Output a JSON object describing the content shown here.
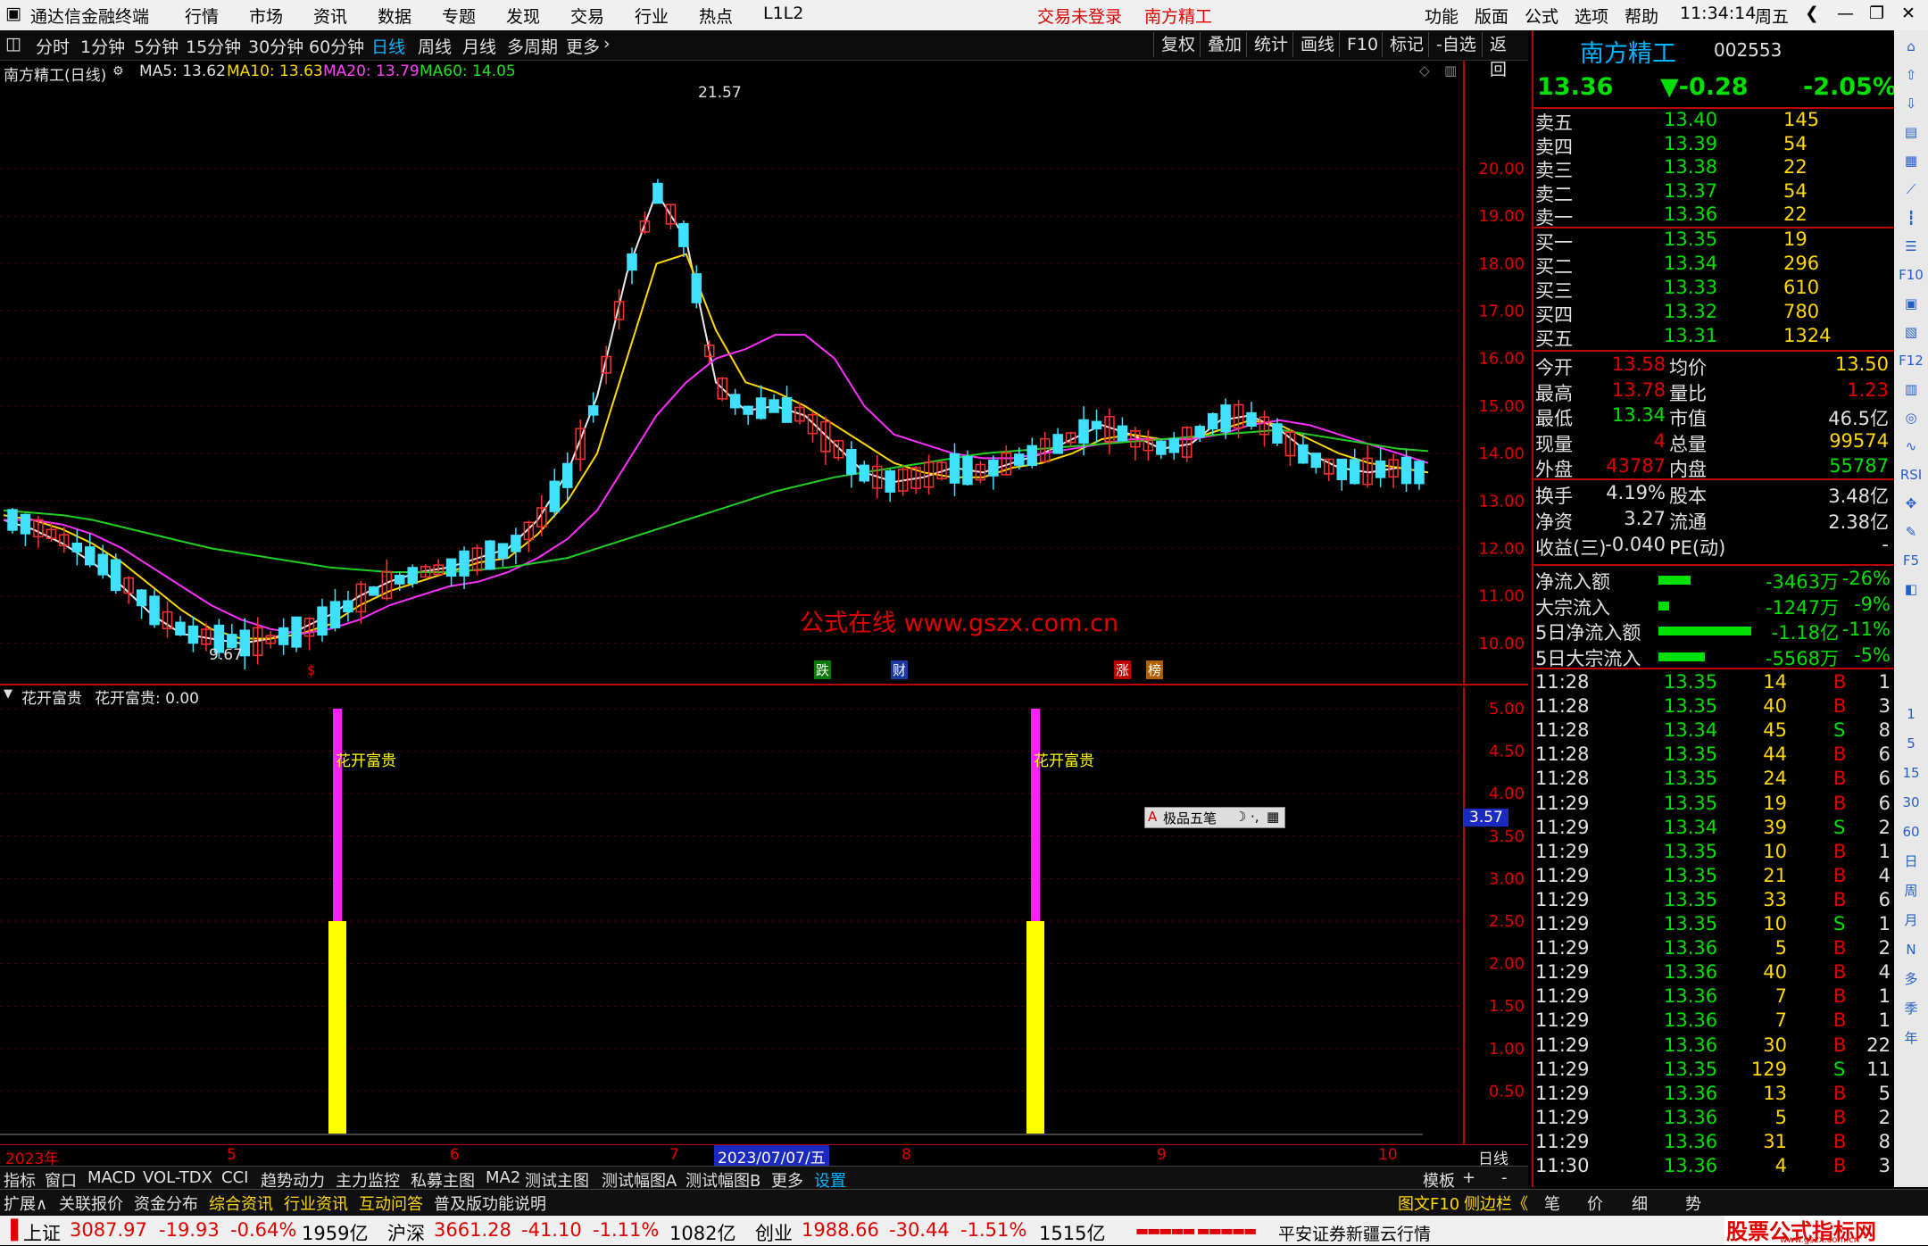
{
  "menubar": {
    "app_title": "通达信金融终端",
    "items": [
      "行情",
      "市场",
      "资讯",
      "数据",
      "专题",
      "发现",
      "交易",
      "行业",
      "热点",
      "L1L2"
    ],
    "login_status": "交易未登录",
    "stock_name": "南方精工",
    "right_items": [
      "功能",
      "版面",
      "公式",
      "选项",
      "帮助"
    ],
    "time": "11:34:14",
    "weekday": "周五"
  },
  "toolbar": {
    "periods": [
      "分时",
      "1分钟",
      "5分钟",
      "15分钟",
      "30分钟",
      "60分钟",
      "日线",
      "周线",
      "月线",
      "多周期",
      "更多"
    ],
    "active_period": "日线",
    "right_buttons": [
      "复权",
      "叠加",
      "统计",
      "画线",
      "F10",
      "标记",
      "-自选",
      "返回"
    ]
  },
  "main_chart": {
    "title": "南方精工(日线)",
    "ma": [
      {
        "label": "MA5: 13.62",
        "color": "#e0e0e0"
      },
      {
        "label": "MA10: 13.63",
        "color": "#ffd800"
      },
      {
        "label": "MA20: 13.79",
        "color": "#ff40ff"
      },
      {
        "label": "MA60: 14.05",
        "color": "#20e020"
      }
    ],
    "high_label": "21.57",
    "low_label": "9.67",
    "watermark": "公式在线  www.gszx.com.cn",
    "event_marks": [
      "$",
      "跌",
      "财",
      "涨",
      "榜"
    ]
  },
  "sub_chart": {
    "title": "花开富贵",
    "value_label": "花开富贵: 0.00",
    "bar_label": "花开富贵",
    "cursor_value": "3.57",
    "ime_label": "极品五笔"
  },
  "chart_data": [
    {
      "type": "bar",
      "title": "南方精工(日线)",
      "y_ticks": [
        20.0,
        19.0,
        18.0,
        17.0,
        16.0,
        15.0,
        14.0,
        13.0,
        12.0,
        11.0,
        10.0
      ],
      "ylim": [
        9.3,
        21.9
      ],
      "x_labels": [
        "2023年",
        "5",
        "6",
        "7",
        "8",
        "9",
        "10"
      ],
      "x_cursor_label": "2023/07/07/五",
      "series": [
        {
          "name": "MA5",
          "values": [
            12.6,
            12.4,
            12.1,
            11.7,
            11.2,
            10.6,
            10.2,
            10.1,
            10.0,
            10.1,
            10.3,
            10.6,
            11.0,
            11.3,
            11.5,
            11.6,
            11.8,
            12.0,
            12.6,
            13.6,
            15.2,
            17.8,
            19.5,
            18.5,
            15.5,
            14.9,
            15.0,
            14.8,
            14.2,
            13.6,
            13.4,
            13.5,
            13.7,
            13.6,
            13.8,
            14.0,
            14.3,
            14.6,
            14.4,
            14.1,
            14.2,
            14.7,
            14.8,
            14.5,
            14.0,
            13.7,
            13.6,
            13.7,
            13.6
          ]
        },
        {
          "name": "MA10",
          "values": [
            12.7,
            12.6,
            12.4,
            12.1,
            11.7,
            11.2,
            10.7,
            10.3,
            10.1,
            10.1,
            10.2,
            10.4,
            10.8,
            11.1,
            11.3,
            11.5,
            11.7,
            11.8,
            12.3,
            13.0,
            14.0,
            16.0,
            18.0,
            18.2,
            16.6,
            15.5,
            15.3,
            15.0,
            14.6,
            14.2,
            13.8,
            13.6,
            13.5,
            13.5,
            13.7,
            13.8,
            14.0,
            14.3,
            14.4,
            14.3,
            14.3,
            14.5,
            14.7,
            14.6,
            14.3,
            14.0,
            13.8,
            13.7,
            13.6
          ]
        },
        {
          "name": "MA20",
          "values": [
            12.6,
            12.6,
            12.5,
            12.3,
            12.0,
            11.6,
            11.2,
            10.8,
            10.5,
            10.3,
            10.2,
            10.3,
            10.5,
            10.8,
            11.0,
            11.2,
            11.3,
            11.5,
            11.8,
            12.2,
            12.8,
            13.8,
            14.8,
            15.5,
            16.0,
            16.2,
            16.5,
            16.5,
            16.0,
            15.0,
            14.4,
            14.2,
            14.0,
            13.9,
            13.9,
            14.0,
            14.1,
            14.2,
            14.3,
            14.3,
            14.3,
            14.4,
            14.6,
            14.7,
            14.6,
            14.4,
            14.2,
            14.0,
            13.8
          ]
        },
        {
          "name": "MA60",
          "values": [
            12.8,
            12.75,
            12.7,
            12.6,
            12.45,
            12.3,
            12.15,
            12.0,
            11.9,
            11.8,
            11.7,
            11.6,
            11.55,
            11.5,
            11.5,
            11.5,
            11.55,
            11.6,
            11.7,
            11.8,
            12.0,
            12.2,
            12.4,
            12.6,
            12.8,
            13.0,
            13.2,
            13.35,
            13.5,
            13.6,
            13.7,
            13.8,
            13.9,
            14.0,
            14.05,
            14.1,
            14.15,
            14.2,
            14.25,
            14.3,
            14.35,
            14.4,
            14.45,
            14.5,
            14.4,
            14.3,
            14.2,
            14.1,
            14.05
          ]
        }
      ]
    },
    {
      "type": "bar",
      "title": "花开富贵",
      "y_ticks": [
        5.0,
        4.5,
        4.0,
        3.5,
        3.0,
        2.5,
        2.0,
        1.5,
        1.0,
        0.5
      ],
      "ylim": [
        0,
        5.0
      ],
      "signals": [
        {
          "x_index": 0,
          "value": 5.0,
          "top_color": "#ff20ff",
          "bottom_value": 2.5,
          "bottom_color": "#ffff00"
        },
        {
          "x_index": 1,
          "value": 5.0,
          "top_color": "#ff20ff",
          "bottom_value": 2.5,
          "bottom_color": "#ffff00"
        }
      ]
    }
  ],
  "quote": {
    "name": "南方精工",
    "code": "002553",
    "price": "13.36",
    "change": "▼-0.28",
    "pct": "-2.05%",
    "asks": [
      {
        "label": "卖五",
        "price": "13.40",
        "vol": "145"
      },
      {
        "label": "卖四",
        "price": "13.39",
        "vol": "54"
      },
      {
        "label": "卖三",
        "price": "13.38",
        "vol": "22"
      },
      {
        "label": "卖二",
        "price": "13.37",
        "vol": "54"
      },
      {
        "label": "卖一",
        "price": "13.36",
        "vol": "22"
      }
    ],
    "bids": [
      {
        "label": "买一",
        "price": "13.35",
        "vol": "19"
      },
      {
        "label": "买二",
        "price": "13.34",
        "vol": "296"
      },
      {
        "label": "买三",
        "price": "13.33",
        "vol": "610"
      },
      {
        "label": "买四",
        "price": "13.32",
        "vol": "780"
      },
      {
        "label": "买五",
        "price": "13.31",
        "vol": "1324"
      }
    ],
    "stats": [
      {
        "l1": "今开",
        "v1": "13.58",
        "l2": "均价",
        "v2": "13.50",
        "c1": "#e00000",
        "c2": "#ffd800"
      },
      {
        "l1": "最高",
        "v1": "13.78",
        "l2": "量比",
        "v2": "1.23",
        "c1": "#e00000",
        "c2": "#e00000"
      },
      {
        "l1": "最低",
        "v1": "13.34",
        "l2": "市值",
        "v2": "46.5亿",
        "c1": "#00e000",
        "c2": "#e0e0e0"
      },
      {
        "l1": "现量",
        "v1": "4",
        "l2": "总量",
        "v2": "99574",
        "c1": "#e00000",
        "c2": "#ffd800"
      },
      {
        "l1": "外盘",
        "v1": "43787",
        "l2": "内盘",
        "v2": "55787",
        "c1": "#e00000",
        "c2": "#00e000"
      }
    ],
    "stats2": [
      {
        "l1": "换手",
        "v1": "4.19%",
        "l2": "股本",
        "v2": "3.48亿"
      },
      {
        "l1": "净资",
        "v1": "3.27",
        "l2": "流通",
        "v2": "2.38亿"
      },
      {
        "l1": "收益(三)",
        "v1": "-0.040",
        "l2": "PE(动)",
        "v2": "-"
      }
    ],
    "flows": [
      {
        "label": "净流入额",
        "bar": 0.35,
        "val": "-3463万",
        "pct": "-26%"
      },
      {
        "label": "大宗流入",
        "bar": 0.12,
        "val": "-1247万",
        "pct": "-9%"
      },
      {
        "label": "5日净流入额",
        "bar": 1.0,
        "val": "-1.18亿",
        "pct": "-11%"
      },
      {
        "label": "5日大宗流入",
        "bar": 0.5,
        "val": "-5568万",
        "pct": "-5%"
      }
    ],
    "ticks": [
      {
        "t": "11:28",
        "p": "13.35",
        "v": "14",
        "d": "B",
        "n": "1"
      },
      {
        "t": "11:28",
        "p": "13.35",
        "v": "40",
        "d": "B",
        "n": "3"
      },
      {
        "t": "11:28",
        "p": "13.34",
        "v": "45",
        "d": "S",
        "n": "8"
      },
      {
        "t": "11:28",
        "p": "13.35",
        "v": "44",
        "d": "B",
        "n": "6"
      },
      {
        "t": "11:28",
        "p": "13.35",
        "v": "24",
        "d": "B",
        "n": "6"
      },
      {
        "t": "11:29",
        "p": "13.35",
        "v": "19",
        "d": "B",
        "n": "6"
      },
      {
        "t": "11:29",
        "p": "13.34",
        "v": "39",
        "d": "S",
        "n": "2"
      },
      {
        "t": "11:29",
        "p": "13.35",
        "v": "10",
        "d": "B",
        "n": "1"
      },
      {
        "t": "11:29",
        "p": "13.35",
        "v": "21",
        "d": "B",
        "n": "4"
      },
      {
        "t": "11:29",
        "p": "13.35",
        "v": "33",
        "d": "B",
        "n": "6"
      },
      {
        "t": "11:29",
        "p": "13.35",
        "v": "10",
        "d": "S",
        "n": "1"
      },
      {
        "t": "11:29",
        "p": "13.36",
        "v": "5",
        "d": "B",
        "n": "2"
      },
      {
        "t": "11:29",
        "p": "13.36",
        "v": "40",
        "d": "B",
        "n": "4"
      },
      {
        "t": "11:29",
        "p": "13.36",
        "v": "7",
        "d": "B",
        "n": "1"
      },
      {
        "t": "11:29",
        "p": "13.36",
        "v": "7",
        "d": "B",
        "n": "1"
      },
      {
        "t": "11:29",
        "p": "13.36",
        "v": "30",
        "d": "B",
        "n": "22"
      },
      {
        "t": "11:29",
        "p": "13.35",
        "v": "129",
        "d": "S",
        "n": "11"
      },
      {
        "t": "11:29",
        "p": "13.36",
        "v": "13",
        "d": "B",
        "n": "5"
      },
      {
        "t": "11:29",
        "p": "13.36",
        "v": "5",
        "d": "B",
        "n": "2"
      },
      {
        "t": "11:29",
        "p": "13.36",
        "v": "31",
        "d": "B",
        "n": "8"
      },
      {
        "t": "11:30",
        "p": "13.36",
        "v": "4",
        "d": "B",
        "n": "3"
      }
    ]
  },
  "side_icons": [
    "1",
    "5",
    "15",
    "30",
    "60",
    "日",
    "周",
    "月",
    "N",
    "多",
    "季",
    "年"
  ],
  "tabs1": [
    "指标",
    "窗口",
    "MACD",
    "VOL-TDX",
    "CCI",
    "趋势动力",
    "主力监控",
    "私募主图",
    "MA2",
    "测试主图",
    "测试幅图A",
    "测试幅图B",
    "更多",
    "设置"
  ],
  "tabs1_right": [
    "模板",
    "+",
    "-"
  ],
  "tabs2": [
    "扩展∧",
    "关联报价",
    "资金分布",
    "综合资讯",
    "行业资讯",
    "互动问答",
    "普及版功能说明"
  ],
  "tabs2_right": [
    "图文F10",
    "侧边栏《",
    "笔",
    "价",
    "细",
    "势"
  ],
  "right_cycle": "日线",
  "status": {
    "sh_label": "上证",
    "sh_val": "3087.97",
    "sh_chg": "-19.93",
    "sh_pct": "-0.64%",
    "sh_amt": "1959亿",
    "sz_label": "沪深",
    "sz_val": "3661.28",
    "sz_chg": "-41.10",
    "sz_pct": "-1.11%",
    "sz_amt": "1082亿",
    "cy_label": "创业",
    "cy_val": "1988.66",
    "cy_chg": "-30.44",
    "cy_pct": "-1.51%",
    "cy_amt": "1515亿",
    "server": "平安证券新疆云行情",
    "brand": "股票公式指标网",
    "brand_url": "www.gszx.com.cn"
  }
}
